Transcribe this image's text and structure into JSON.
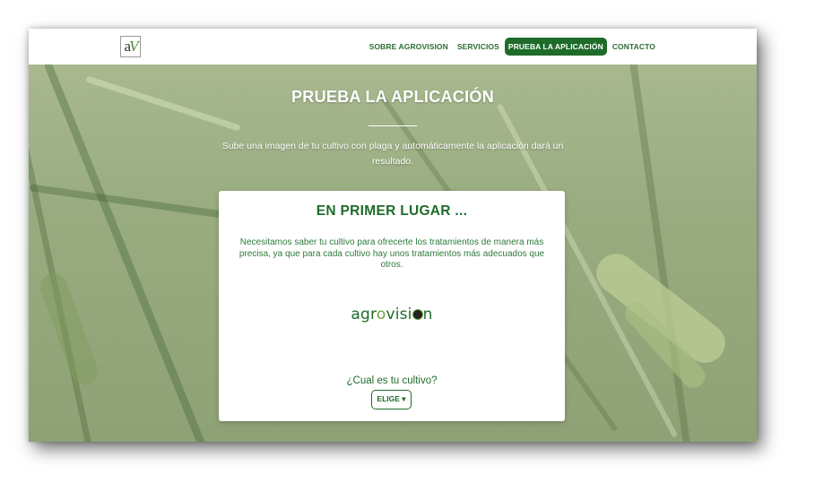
{
  "navbar": {
    "logo_text_a": "a",
    "logo_text_v": "V",
    "items": [
      {
        "label": "SOBRE AGROVISION"
      },
      {
        "label": "SERVICIOS"
      },
      {
        "label": "PRUEBA LA APLICACIÓN"
      },
      {
        "label": "CONTACTO"
      }
    ],
    "active_color": "#1e6b2a"
  },
  "hero": {
    "title": "PRUEBA LA APLICACIÓN",
    "subtitle": "Sube una imagen de tu cultivo con plaga y automáticamente la aplicación dará un resultado."
  },
  "card": {
    "title": "EN PRIMER LUGAR ...",
    "text": "Necesitamos saber tu cultivo para ofrecerte los tratamientos de manera más precisa, ya que para cada cultivo hay unos tratamientos más adecuados que otros.",
    "brand": {
      "part1": "agr",
      "part2": "o",
      "part3": "visi",
      "part5": "n"
    },
    "question": "¿Cual es tu cultivo?",
    "button_label": "ELIGE ▾"
  },
  "colors": {
    "brand_green": "#1e6b2a",
    "accent_green": "#6aa238"
  }
}
